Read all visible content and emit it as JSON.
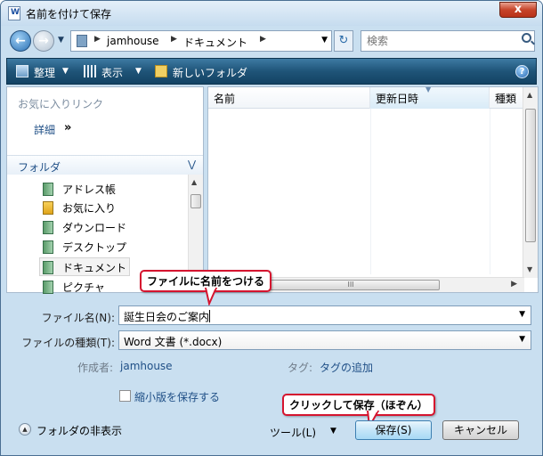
{
  "window": {
    "title": "名前を付けて保存",
    "close_glyph": "x"
  },
  "address": {
    "crumbs": [
      "jamhouse",
      "ドキュメント"
    ],
    "search_placeholder": "検索"
  },
  "toolbar": {
    "organize": "整理",
    "views": "表示",
    "new_folder": "新しいフォルダ",
    "dropdown_glyph": "▼",
    "help_glyph": "?"
  },
  "left": {
    "favorites_title": "お気に入りリンク",
    "details_link": "詳細",
    "details_chevron": "»",
    "folder_header": "フォルダ",
    "folder_items": [
      {
        "label": "アドレス帳",
        "icon": "contacts-icon"
      },
      {
        "label": "お気に入り",
        "icon": "favorites-icon"
      },
      {
        "label": "ダウンロード",
        "icon": "downloads-icon"
      },
      {
        "label": "デスクトップ",
        "icon": "desktop-icon"
      },
      {
        "label": "ドキュメント",
        "icon": "documents-icon",
        "selected": true
      },
      {
        "label": "ピクチャ",
        "icon": "pictures-icon"
      }
    ]
  },
  "filelist": {
    "columns": [
      "名前",
      "更新日時",
      "種類"
    ],
    "sorted_column": 1,
    "hscroll_grip": "III"
  },
  "callouts": {
    "filename": "ファイルに名前をつける",
    "save": "クリックして保存（ほぞん）"
  },
  "form": {
    "filename_label": "ファイル名(N):",
    "filename_value": "誕生日会のご案内",
    "filetype_label": "ファイルの種類(T):",
    "filetype_value": "Word 文書 (*.docx)",
    "author_label": "作成者:",
    "author_value": "jamhouse",
    "tags_label": "タグ:",
    "tags_value": "タグの追加",
    "thumbnail_label": "縮小版を保存する",
    "thumbnail_checked": false
  },
  "footer": {
    "hide_folders": "フォルダの非表示",
    "tools": "ツール(L)",
    "save": "保存(S)",
    "cancel": "キャンセル"
  },
  "colors": {
    "callout_border": "#d5142f",
    "link": "#1f4f86",
    "toolbar": "#1f5478"
  }
}
